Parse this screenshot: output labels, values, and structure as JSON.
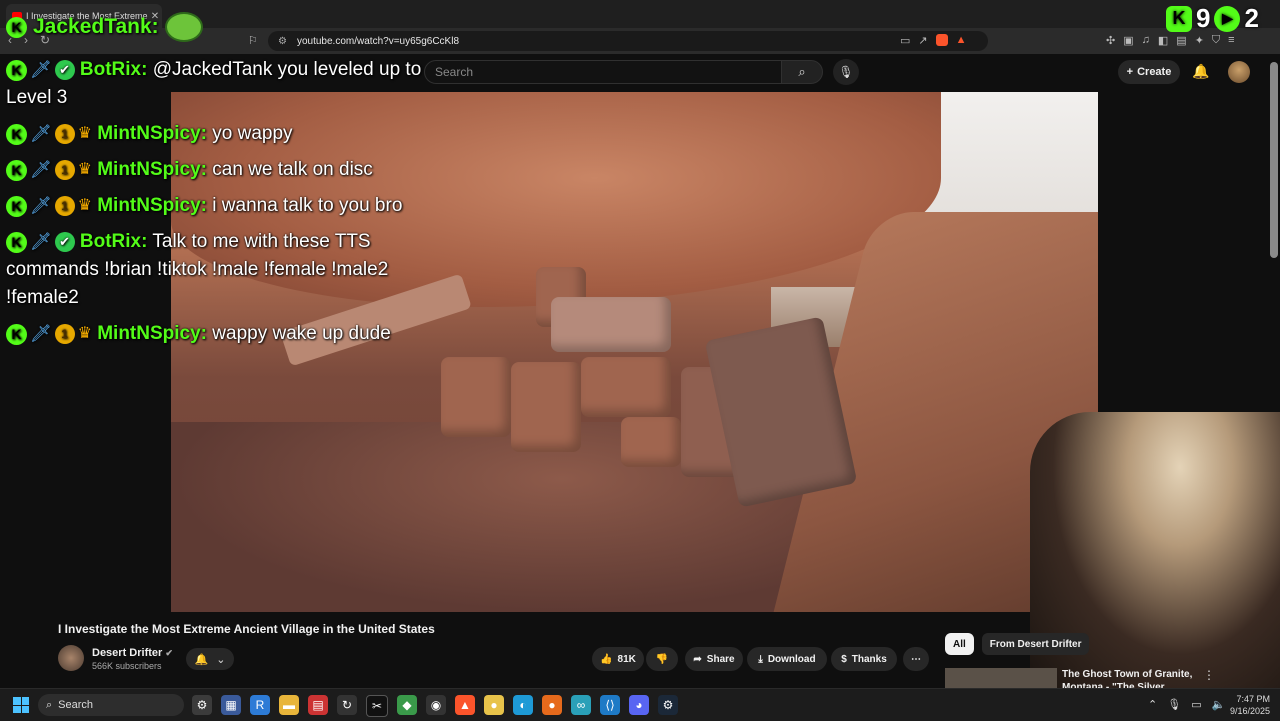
{
  "browser": {
    "tab_title": "I Investigate the Most Extreme",
    "url": "youtube.com/watch?v=uy65g6CcKl8"
  },
  "youtube": {
    "search_placeholder": "Search",
    "create_label": "Create",
    "video_title": "I Investigate the Most Extreme Ancient Village in the United States",
    "channel_name": "Desert Drifter",
    "subscribers": "566K subscribers",
    "likes": "81K",
    "share_label": "Share",
    "download_label": "Download",
    "thanks_label": "Thanks",
    "chip_all": "All",
    "chip_from": "From Desert Drifter",
    "rec_title": "The Ghost Town of Granite, Montana - \"The Silver Queen\""
  },
  "overlay": {
    "streamer": "JackedTank:",
    "kick_count": "9",
    "viewer_count": "2"
  },
  "chat": [
    {
      "user": "BotRix:",
      "badges": [
        "kick",
        "sword",
        "check"
      ],
      "text": "@JackedTank you leveled up to Level 3"
    },
    {
      "user": "MintNSpicy:",
      "badges": [
        "kick",
        "sword",
        "sub",
        "crown"
      ],
      "text": "yo wappy"
    },
    {
      "user": "MintNSpicy:",
      "badges": [
        "kick",
        "sword",
        "sub",
        "crown"
      ],
      "text": "can we talk on disc"
    },
    {
      "user": "MintNSpicy:",
      "badges": [
        "kick",
        "sword",
        "sub",
        "crown"
      ],
      "text": "i wanna talk to you bro"
    },
    {
      "user": "BotRix:",
      "badges": [
        "kick",
        "sword",
        "check"
      ],
      "text": "Talk to me with these TTS commands !brian !tiktok !male !female !male2 !female2"
    },
    {
      "user": "MintNSpicy:",
      "badges": [
        "kick",
        "sword",
        "sub",
        "crown"
      ],
      "text": "wappy wake up dude"
    }
  ],
  "taskbar": {
    "search_label": "Search",
    "time": "7:47 PM",
    "date": "9/16/2025"
  },
  "colors": {
    "kick_green": "#53fc18",
    "youtube_red": "#ff0000",
    "background": "#0f0f0f"
  }
}
